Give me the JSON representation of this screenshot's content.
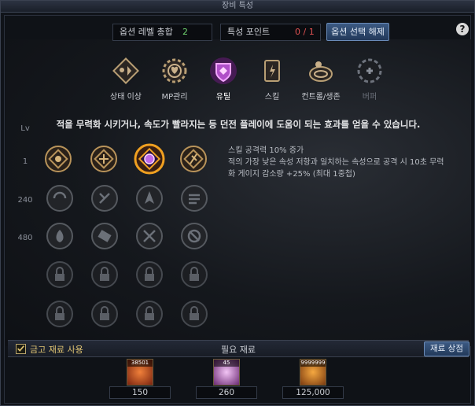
{
  "window": {
    "title": "장비 특성"
  },
  "header": {
    "option_level_label": "옵션 레벨 총합",
    "option_level_value": "2",
    "trait_points_label": "특성 포인트",
    "trait_points_value": "0 / 1",
    "reset_button": "옵션 선택 해제",
    "help": "?"
  },
  "tabs": [
    {
      "label": "상태 이상",
      "icon": "status-effect-icon"
    },
    {
      "label": "MP관리",
      "icon": "mp-gear-icon"
    },
    {
      "label": "유틸",
      "icon": "utility-shield-icon",
      "active": true
    },
    {
      "label": "스킬",
      "icon": "skill-book-icon"
    },
    {
      "label": "컨트롤/생존",
      "icon": "control-survival-icon"
    },
    {
      "label": "버퍼",
      "icon": "buffer-plus-icon",
      "disabled": true
    }
  ],
  "description": "적을 무력화 시키거나, 속도가 빨라지는 등 던전 플레이에 도움이 되는 효과를 얻을 수 있습니다.",
  "levels": {
    "header": "Lv",
    "rows": [
      "1",
      "240",
      "480"
    ]
  },
  "tooltip": {
    "line1": "스킬 공격력 10% 증가",
    "line2": "적의 가장 낮은 속성 저항과 일치하는 속성으로 공격 시 10초 무력",
    "line3": "화 게이지 감소량 +25% (최대 1중첩)"
  },
  "footer": {
    "use_storage_label": "금고 재료 사용",
    "use_storage_checked": true,
    "required_title": "필요 재료",
    "shop_button": "재료 상점"
  },
  "materials": [
    {
      "stock": "38501",
      "required": "150",
      "color": "#e0572a"
    },
    {
      "stock": "45",
      "required": "260",
      "color": "#c77ad1"
    },
    {
      "stock": "9999999",
      "required": "125,000",
      "color": "#d8832a"
    }
  ],
  "colors": {
    "accent": "#6a8bb8",
    "gold": "#b8935a",
    "selected": "#f0a020",
    "points_red": "#e25252",
    "level_green": "#6fd36f"
  }
}
